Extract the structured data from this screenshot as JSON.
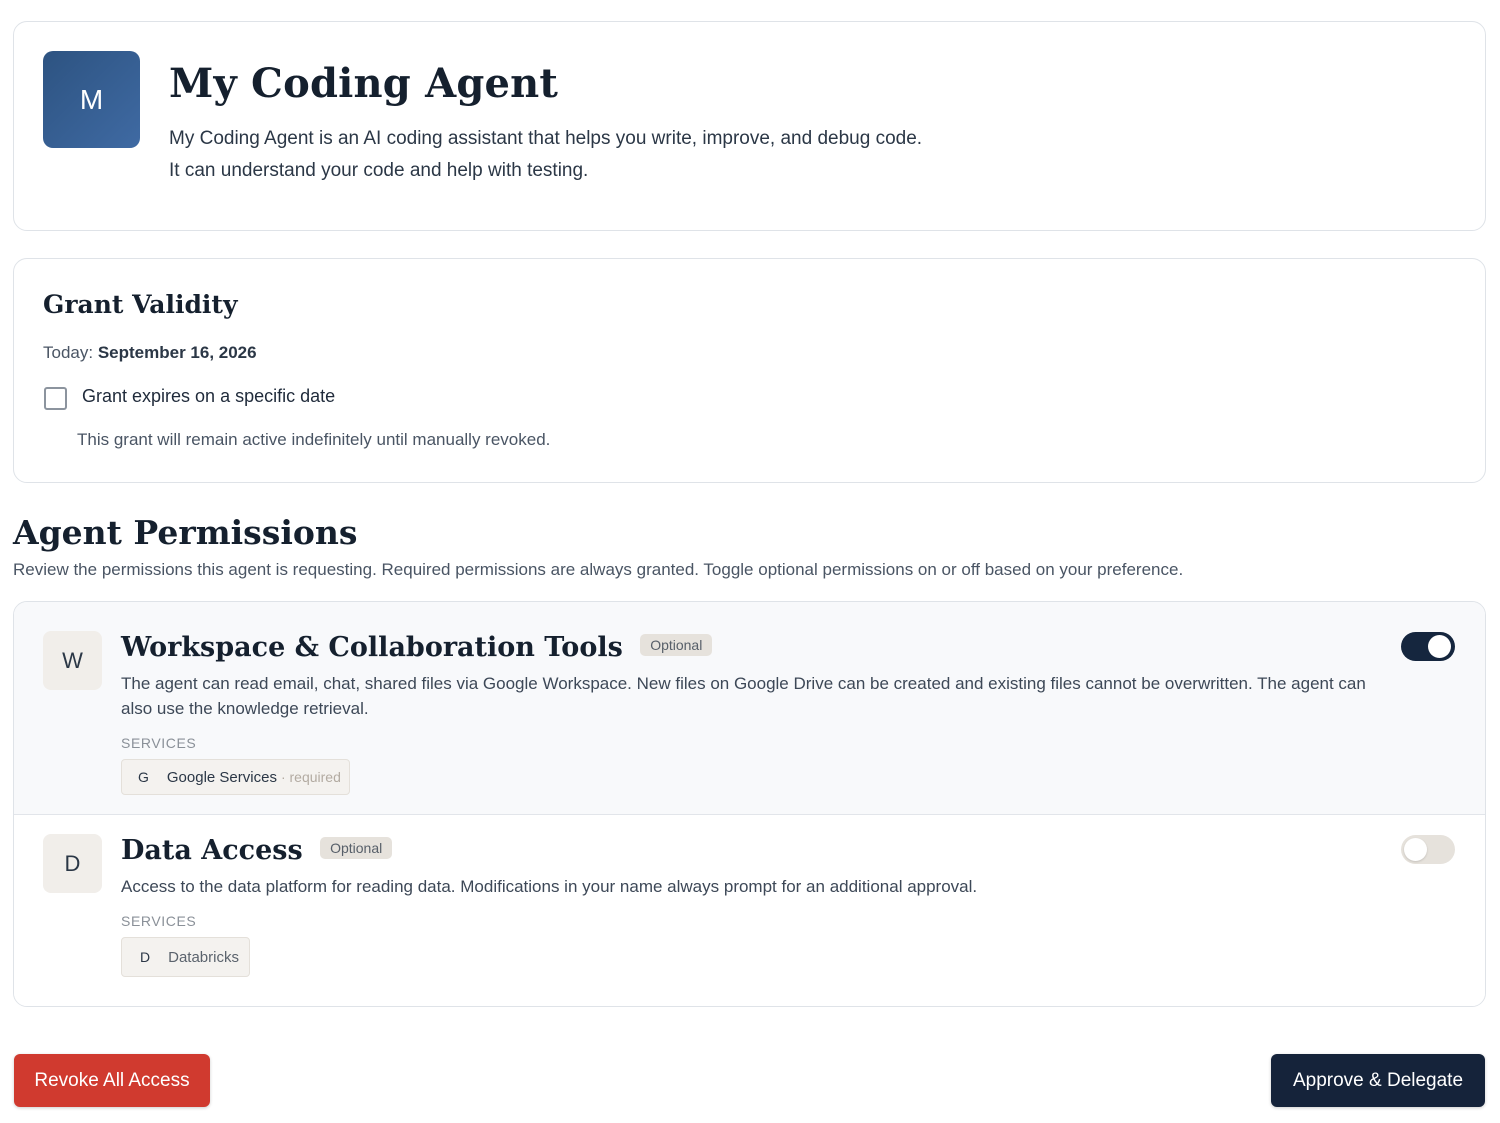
{
  "agent": {
    "avatar_letter": "M",
    "name": "My Coding Agent",
    "description_line1": "My Coding Agent is an AI coding assistant that helps you write, improve, and debug code.",
    "description_line2": "It can understand your code and help with testing."
  },
  "grant_validity": {
    "title": "Grant Validity",
    "today_label": "Today:",
    "today_value": "September 16, 2026",
    "expiry_checkbox_label": "Grant expires on a specific date",
    "expiry_checked": false,
    "note": "This grant will remain active indefinitely until manually revoked."
  },
  "permissions": {
    "title": "Agent Permissions",
    "subtitle": "Review the permissions this agent is requesting. Required permissions are always granted. Toggle optional permissions on or off based on your preference.",
    "services_label": "SERVICES",
    "items": [
      {
        "icon_letter": "W",
        "title": "Workspace & Collaboration Tools",
        "badge": "Optional",
        "description": "The agent can read email, chat, shared files via Google Workspace. New files on Google Drive can be created and existing files cannot be overwritten. The agent can also use the knowledge retrieval.",
        "enabled": true,
        "services": [
          {
            "letter": "G",
            "name": "Google Services",
            "suffix": "· required"
          }
        ]
      },
      {
        "icon_letter": "D",
        "title": "Data Access",
        "badge": "Optional",
        "description": "Access to the data platform for reading data. Modifications in your name always prompt for an additional approval.",
        "enabled": false,
        "services": [
          {
            "letter": "D",
            "name": "Databricks"
          }
        ]
      }
    ]
  },
  "actions": {
    "revoke_label": "Revoke All Access",
    "approve_label": "Approve & Delegate"
  },
  "colors": {
    "avatar": "#3f6aa3",
    "toggle_on": "#15263e",
    "revoke": "#d03a2f",
    "approve": "#15233a"
  }
}
